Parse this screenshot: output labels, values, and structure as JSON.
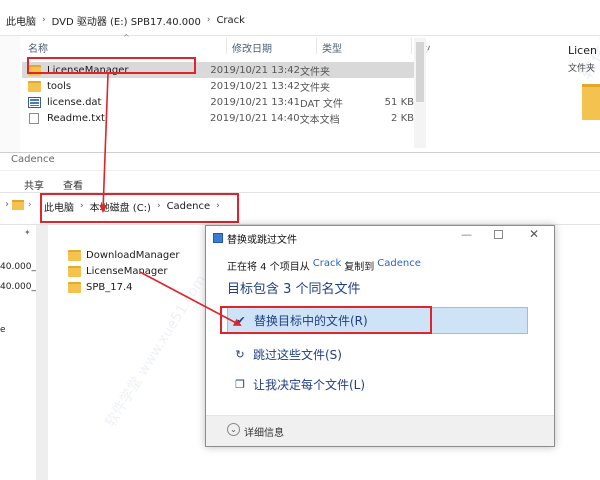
{
  "top_window": {
    "breadcrumb": [
      "此电脑",
      "DVD 驱动器 (E:) SPB17.40.000",
      "Crack"
    ],
    "columns": {
      "name": "名称",
      "date": "修改日期",
      "type": "类型",
      "size": "大小"
    },
    "files": [
      {
        "name": "LicenseManager",
        "date": "2019/10/21 13:42",
        "type": "文件夹",
        "size": "",
        "icon": "folder-icon"
      },
      {
        "name": "tools",
        "date": "2019/10/21 13:42",
        "type": "文件夹",
        "size": "",
        "icon": "folder-icon"
      },
      {
        "name": "license.dat",
        "date": "2019/10/21 13:41",
        "type": "DAT 文件",
        "size": "51 KB",
        "icon": "dat-file-icon"
      },
      {
        "name": "Readme.txt",
        "date": "2019/10/21 14:40",
        "type": "文本文档",
        "size": "2 KB",
        "icon": "text-file-icon"
      }
    ],
    "preview": {
      "title": "Licen",
      "subtitle": "文件夹"
    }
  },
  "bottom_window": {
    "title": "Cadence",
    "ribbon": {
      "share": "共享",
      "view": "查看"
    },
    "breadcrumb": [
      "此电脑",
      "本地磁盘 (C:)",
      "Cadence"
    ],
    "left_fragments": [
      "40.000_F",
      "40.000_L",
      "e"
    ],
    "folders": [
      "DownloadManager",
      "LicenseManager",
      "SPB_17.4"
    ]
  },
  "dialog": {
    "title": "替换或跳过文件",
    "progress": {
      "prefix": "正在将 4 个项目从",
      "source": "Crack",
      "middle": "复制到",
      "dest": "Cadence"
    },
    "heading": "目标包含 3 个同名文件",
    "options": {
      "replace": "替换目标中的文件(R)",
      "skip": "跳过这些文件(S)",
      "decide": "让我决定每个文件(L)"
    },
    "details": "详细信息"
  },
  "watermark": {
    "text": "软件学堂 www.xue51.com"
  },
  "colors": {
    "annotation_red": "#e0242b",
    "link_blue": "#2767b8",
    "dialog_text": "#1f3f84",
    "selection_blue": "#cfe3f7"
  }
}
